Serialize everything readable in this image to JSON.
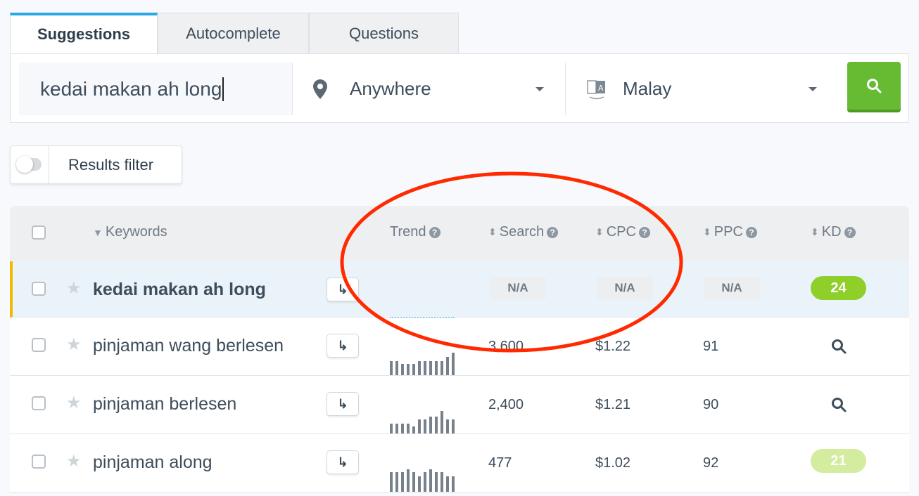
{
  "tabs": [
    {
      "label": "Suggestions",
      "active": true
    },
    {
      "label": "Autocomplete"
    },
    {
      "label": "Questions"
    }
  ],
  "search": {
    "keyword": "kedai makan ah long",
    "location": "Anywhere",
    "language": "Malay",
    "location_icon": "map-pin-icon",
    "language_icon": "translate-icon",
    "button_icon": "search-icon",
    "button_color": "#66bb33"
  },
  "filter": {
    "label": "Results filter",
    "enabled": false
  },
  "table": {
    "headers": {
      "keywords": "Keywords",
      "trend": "Trend",
      "search": "Search",
      "cpc": "CPC",
      "ppc": "PPC",
      "kd": "KD"
    },
    "rows": [
      {
        "keyword": "kedai makan ah long",
        "search": "N/A",
        "cpc": "N/A",
        "ppc": "N/A",
        "kd": "24",
        "kd_color": "#8fcf2a",
        "trend": [],
        "highlight": true
      },
      {
        "keyword": "pinjaman wang berlesen",
        "search": "3,600",
        "cpc": "$1.22",
        "ppc": "91",
        "kd": null,
        "trend": [
          5,
          5,
          4,
          4,
          4,
          5,
          5,
          5,
          5,
          5,
          6.5,
          8
        ]
      },
      {
        "keyword": "pinjaman berlesen",
        "search": "2,400",
        "cpc": "$1.21",
        "ppc": "90",
        "kd": null,
        "trend": [
          3.5,
          3.5,
          3.5,
          3.5,
          2.5,
          5,
          5,
          6,
          6,
          8,
          5,
          5
        ]
      },
      {
        "keyword": "pinjaman along",
        "search": "477",
        "cpc": "$1.02",
        "ppc": "92",
        "kd": "21",
        "kd_color": "#d4ec9e",
        "trend": [
          7,
          7,
          7,
          8,
          7,
          5.5,
          7,
          8,
          7,
          7,
          5.5,
          5.5
        ]
      }
    ]
  },
  "annotation": {
    "shape": "ellipse",
    "color": "#ff2a00"
  }
}
